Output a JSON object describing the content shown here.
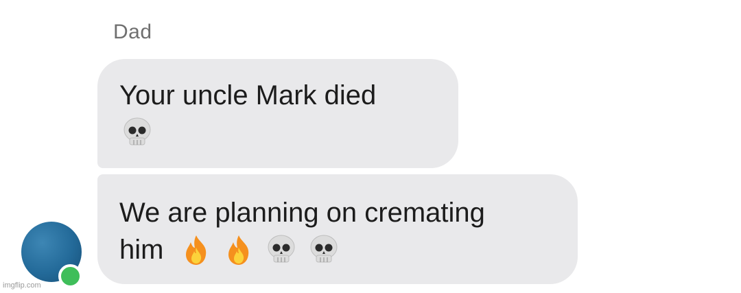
{
  "conversation": {
    "sender_name": "Dad",
    "messages": [
      {
        "lines": [
          "Your uncle Mark died"
        ],
        "emojis": [
          "skull-emoji"
        ]
      },
      {
        "lines": [
          "We are planning on cremating",
          "him"
        ],
        "emojis": [
          "fire-emoji",
          "fire-emoji",
          "skull-emoji",
          "skull-emoji"
        ]
      }
    ]
  },
  "avatar": {
    "color": "#236a99",
    "status": "online",
    "status_color": "#3fbe5a"
  },
  "colors": {
    "bubble_background": "#e9e9eb",
    "text": "#1c1c1c",
    "sender_name": "#6f6f6f"
  },
  "watermark": {
    "text": "imgflip.com"
  }
}
